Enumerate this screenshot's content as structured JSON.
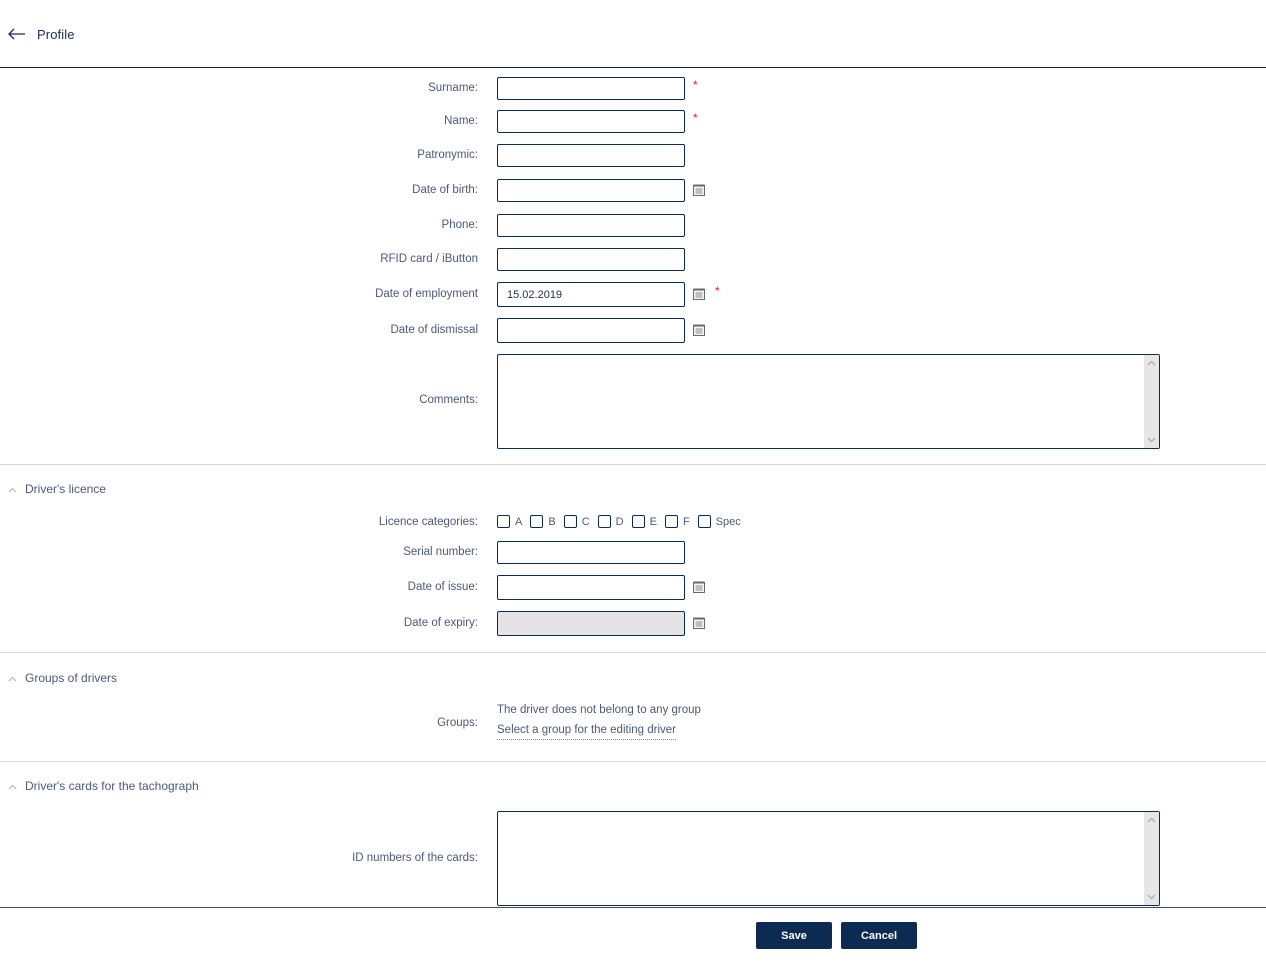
{
  "header": {
    "back_icon": "arrow-left-icon",
    "title": "Profile"
  },
  "profile": {
    "surname": {
      "label": "Surname:",
      "value": "",
      "required": true
    },
    "name": {
      "label": "Name:",
      "value": "",
      "required": true
    },
    "patronymic": {
      "label": "Patronymic:",
      "value": ""
    },
    "date_of_birth": {
      "label": "Date of birth:",
      "value": "",
      "icon": "calendar-icon"
    },
    "phone": {
      "label": "Phone:",
      "value": ""
    },
    "rfid": {
      "label": "RFID card / iButton",
      "value": ""
    },
    "date_of_employment": {
      "label": "Date of employment",
      "value": "15.02.2019",
      "icon": "calendar-icon",
      "required": true
    },
    "date_of_dismissal": {
      "label": "Date of dismissal",
      "value": "",
      "icon": "calendar-icon"
    },
    "comments": {
      "label": "Comments:",
      "value": ""
    },
    "required_mark": "*"
  },
  "licence": {
    "section_title": "Driver's licence",
    "categories_label": "Licence categories:",
    "categories": [
      {
        "label": "A",
        "checked": false
      },
      {
        "label": "B",
        "checked": false
      },
      {
        "label": "C",
        "checked": false
      },
      {
        "label": "D",
        "checked": false
      },
      {
        "label": "E",
        "checked": false
      },
      {
        "label": "F",
        "checked": false
      },
      {
        "label": "Spec",
        "checked": false
      }
    ],
    "serial_number": {
      "label": "Serial number:",
      "value": ""
    },
    "date_of_issue": {
      "label": "Date of issue:",
      "value": ""
    },
    "date_of_expiry": {
      "label": "Date of expiry:",
      "value": "",
      "disabled": true
    }
  },
  "groups": {
    "section_title": "Groups of drivers",
    "label": "Groups:",
    "note": "The driver does not belong to any group",
    "select_link": "Select a group for the editing driver"
  },
  "tachograph": {
    "section_title": "Driver's cards for the tachograph",
    "label": "ID numbers of the cards:",
    "value": ""
  },
  "footer": {
    "save_label": "Save",
    "cancel_label": "Cancel"
  },
  "colors": {
    "primary": "#0d2a52",
    "required": "#e02020",
    "text": "#4a5a78",
    "disabled_bg": "#e4e4e4"
  }
}
